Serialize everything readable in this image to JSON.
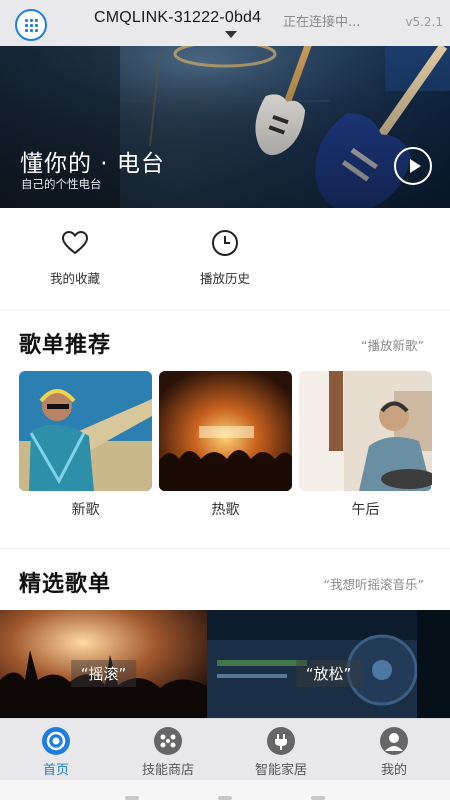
{
  "header": {
    "device_name": "CMQLINK-31222-0bd4",
    "status": "正在连接中...",
    "version": "v5.2.1"
  },
  "hero": {
    "title": "懂你的 · 电台",
    "subtitle": "自己的个性电台"
  },
  "quick_actions": [
    {
      "label": "我的收藏",
      "icon": "heart-icon"
    },
    {
      "label": "播放历史",
      "icon": "clock-icon"
    }
  ],
  "recommend": {
    "title": "歌单推荐",
    "link": "“播放新歌”",
    "items": [
      {
        "label": "新歌"
      },
      {
        "label": "热歌"
      },
      {
        "label": "午后"
      }
    ]
  },
  "featured": {
    "title": "精选歌单",
    "link": "“我想听摇滚音乐”",
    "items": [
      {
        "label": "“摇滚”"
      },
      {
        "label": "“放松”"
      }
    ]
  },
  "tabs": [
    {
      "label": "首页",
      "icon": "home-icon",
      "active": true
    },
    {
      "label": "技能商店",
      "icon": "store-icon",
      "active": false
    },
    {
      "label": "智能家居",
      "icon": "plug-icon",
      "active": false
    },
    {
      "label": "我的",
      "icon": "user-icon",
      "active": false
    }
  ],
  "colors": {
    "accent": "#1e7de0",
    "header_bg": "#e9e9eb",
    "tabbar_bg": "#e8e8ea"
  }
}
